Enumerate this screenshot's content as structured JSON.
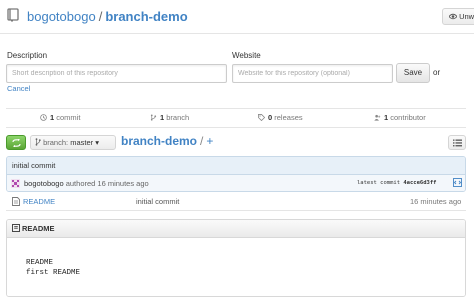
{
  "header": {
    "owner": "bogotobogo",
    "separator": "/",
    "repo": "branch-demo",
    "watch_label": "Unwatch"
  },
  "form": {
    "description_label": "Description",
    "website_label": "Website",
    "description_placeholder": "Short description of this repository",
    "website_placeholder": "Website for this repository (optional)",
    "save_label": "Save",
    "or_label": "or",
    "cancel_label": "Cancel"
  },
  "stats": {
    "commits_count": "1",
    "commits_label": "commit",
    "branches_count": "1",
    "branches_label": "branch",
    "releases_count": "0",
    "releases_label": "releases",
    "contributors_count": "1",
    "contributors_label": "contributor"
  },
  "branch_bar": {
    "branch_prefix": "branch:",
    "branch_name": "master",
    "breadcrumb_repo": "branch-demo",
    "breadcrumb_sep": "/",
    "breadcrumb_add": "+"
  },
  "commit": {
    "message": "initial commit",
    "author": "bogotobogo",
    "authored_text": "authored 16 minutes ago",
    "latest_label": "latest commit",
    "sha": "4acce6d3ff"
  },
  "files": [
    {
      "name": "README",
      "message": "initial commit",
      "age": "16 minutes ago"
    }
  ],
  "readme": {
    "title": "README",
    "lines": [
      "README",
      "first README"
    ]
  },
  "colors": {
    "link": "#4183c4",
    "sync_green": "#6cc644",
    "commit_bg": "#e7f0f8"
  },
  "icons": [
    "repo-icon",
    "eye-icon",
    "history-icon",
    "branch-icon",
    "tag-icon",
    "people-icon",
    "sync-icon",
    "list-icon",
    "avatar",
    "browse-code-icon",
    "file-icon",
    "book-icon"
  ]
}
